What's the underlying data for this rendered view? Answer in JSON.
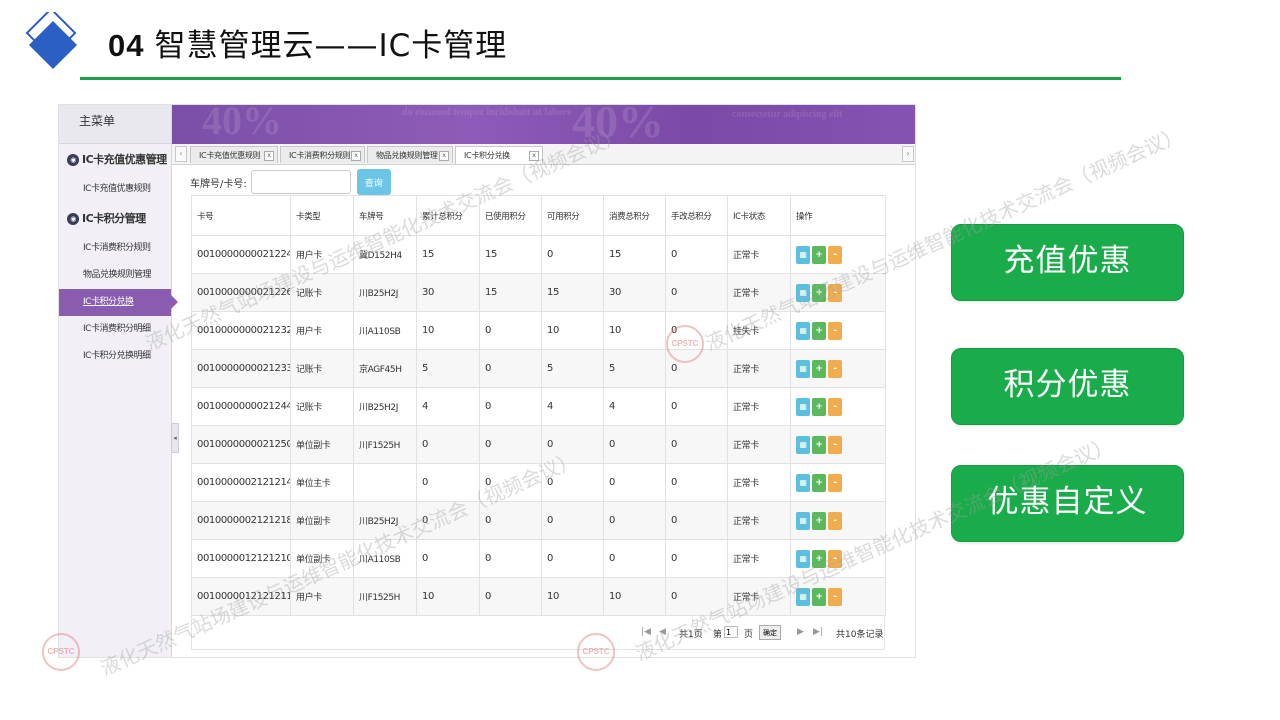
{
  "slide": {
    "number": "04",
    "title": "智慧管理云——IC卡管理"
  },
  "sidebar": {
    "header": "主菜单",
    "groups": [
      {
        "label": "IC卡充值优惠管理",
        "items": [
          "IC卡充值优惠规则"
        ]
      },
      {
        "label": "IC卡积分管理",
        "items": [
          "IC卡消费积分规则",
          "物品兑换规则管理",
          "IC卡积分兑换",
          "IC卡消费积分明细",
          "IC卡积分兑换明细"
        ]
      }
    ],
    "active_item": "IC卡积分兑换"
  },
  "tabs": [
    {
      "label": "IC卡充值优惠规则",
      "close": "x"
    },
    {
      "label": "IC卡消费积分规则",
      "close": "x"
    },
    {
      "label": "物品兑换规则管理",
      "close": "x"
    },
    {
      "label": "IC卡积分兑换",
      "close": "x"
    }
  ],
  "search": {
    "label": "车牌号/卡号:",
    "value": "",
    "button": "查询"
  },
  "table": {
    "columns": [
      "卡号",
      "卡类型",
      "车牌号",
      "累计总积分",
      "已使用积分",
      "可用积分",
      "消费总积分",
      "手改总积分",
      "IC卡状态",
      "操作"
    ],
    "rows": [
      [
        "0010000000021224",
        "用户卡",
        "冀D152H4",
        "15",
        "15",
        "0",
        "15",
        "0",
        "正常卡"
      ],
      [
        "0010000000021226",
        "记账卡",
        "川B25H2J",
        "30",
        "15",
        "15",
        "30",
        "0",
        "正常卡"
      ],
      [
        "0010000000021232",
        "用户卡",
        "川A110SB",
        "10",
        "0",
        "10",
        "10",
        "0",
        "挂失卡"
      ],
      [
        "0010000000021233",
        "记账卡",
        "京AGF45H",
        "5",
        "0",
        "5",
        "5",
        "0",
        "正常卡"
      ],
      [
        "0010000000021244",
        "记账卡",
        "川B25H2J",
        "4",
        "0",
        "4",
        "4",
        "0",
        "正常卡"
      ],
      [
        "0010000000021250",
        "单位副卡",
        "川F1525H",
        "0",
        "0",
        "0",
        "0",
        "0",
        "正常卡"
      ],
      [
        "0010000002121214",
        "单位主卡",
        "",
        "0",
        "0",
        "0",
        "0",
        "0",
        "正常卡"
      ],
      [
        "0010000002121218",
        "单位副卡",
        "川B25H2J",
        "0",
        "0",
        "0",
        "0",
        "0",
        "正常卡"
      ],
      [
        "0010000012121210",
        "单位副卡",
        "川A110SB",
        "0",
        "0",
        "0",
        "0",
        "0",
        "正常卡"
      ],
      [
        "0010000012121211",
        "用户卡",
        "川F1525H",
        "10",
        "0",
        "10",
        "10",
        "0",
        "正常卡"
      ]
    ],
    "actions": {
      "view": "▦",
      "add": "+",
      "subtract": "-"
    }
  },
  "pager": {
    "total_pages_text": "共1页",
    "page_prefix": "第",
    "page_value": "1",
    "page_suffix": "页",
    "confirm": "确定",
    "total_records": "共10条记录",
    "first": "|◀",
    "prev": "◀",
    "next": "▶",
    "last": "▶|"
  },
  "options": [
    "充值优惠",
    "积分优惠",
    "优惠自定义"
  ],
  "watermark": {
    "text": "液化天然气站场建设与运维智能化技术交流会（视频会议）",
    "logo": "CPSTC"
  },
  "colors": {
    "accent_green": "#1aac4b",
    "title_line": "#1aa346",
    "banner_purple": "#7b4fa8",
    "active_menu": "#8a5cb0",
    "logo_blue": "#2b5fc4"
  }
}
